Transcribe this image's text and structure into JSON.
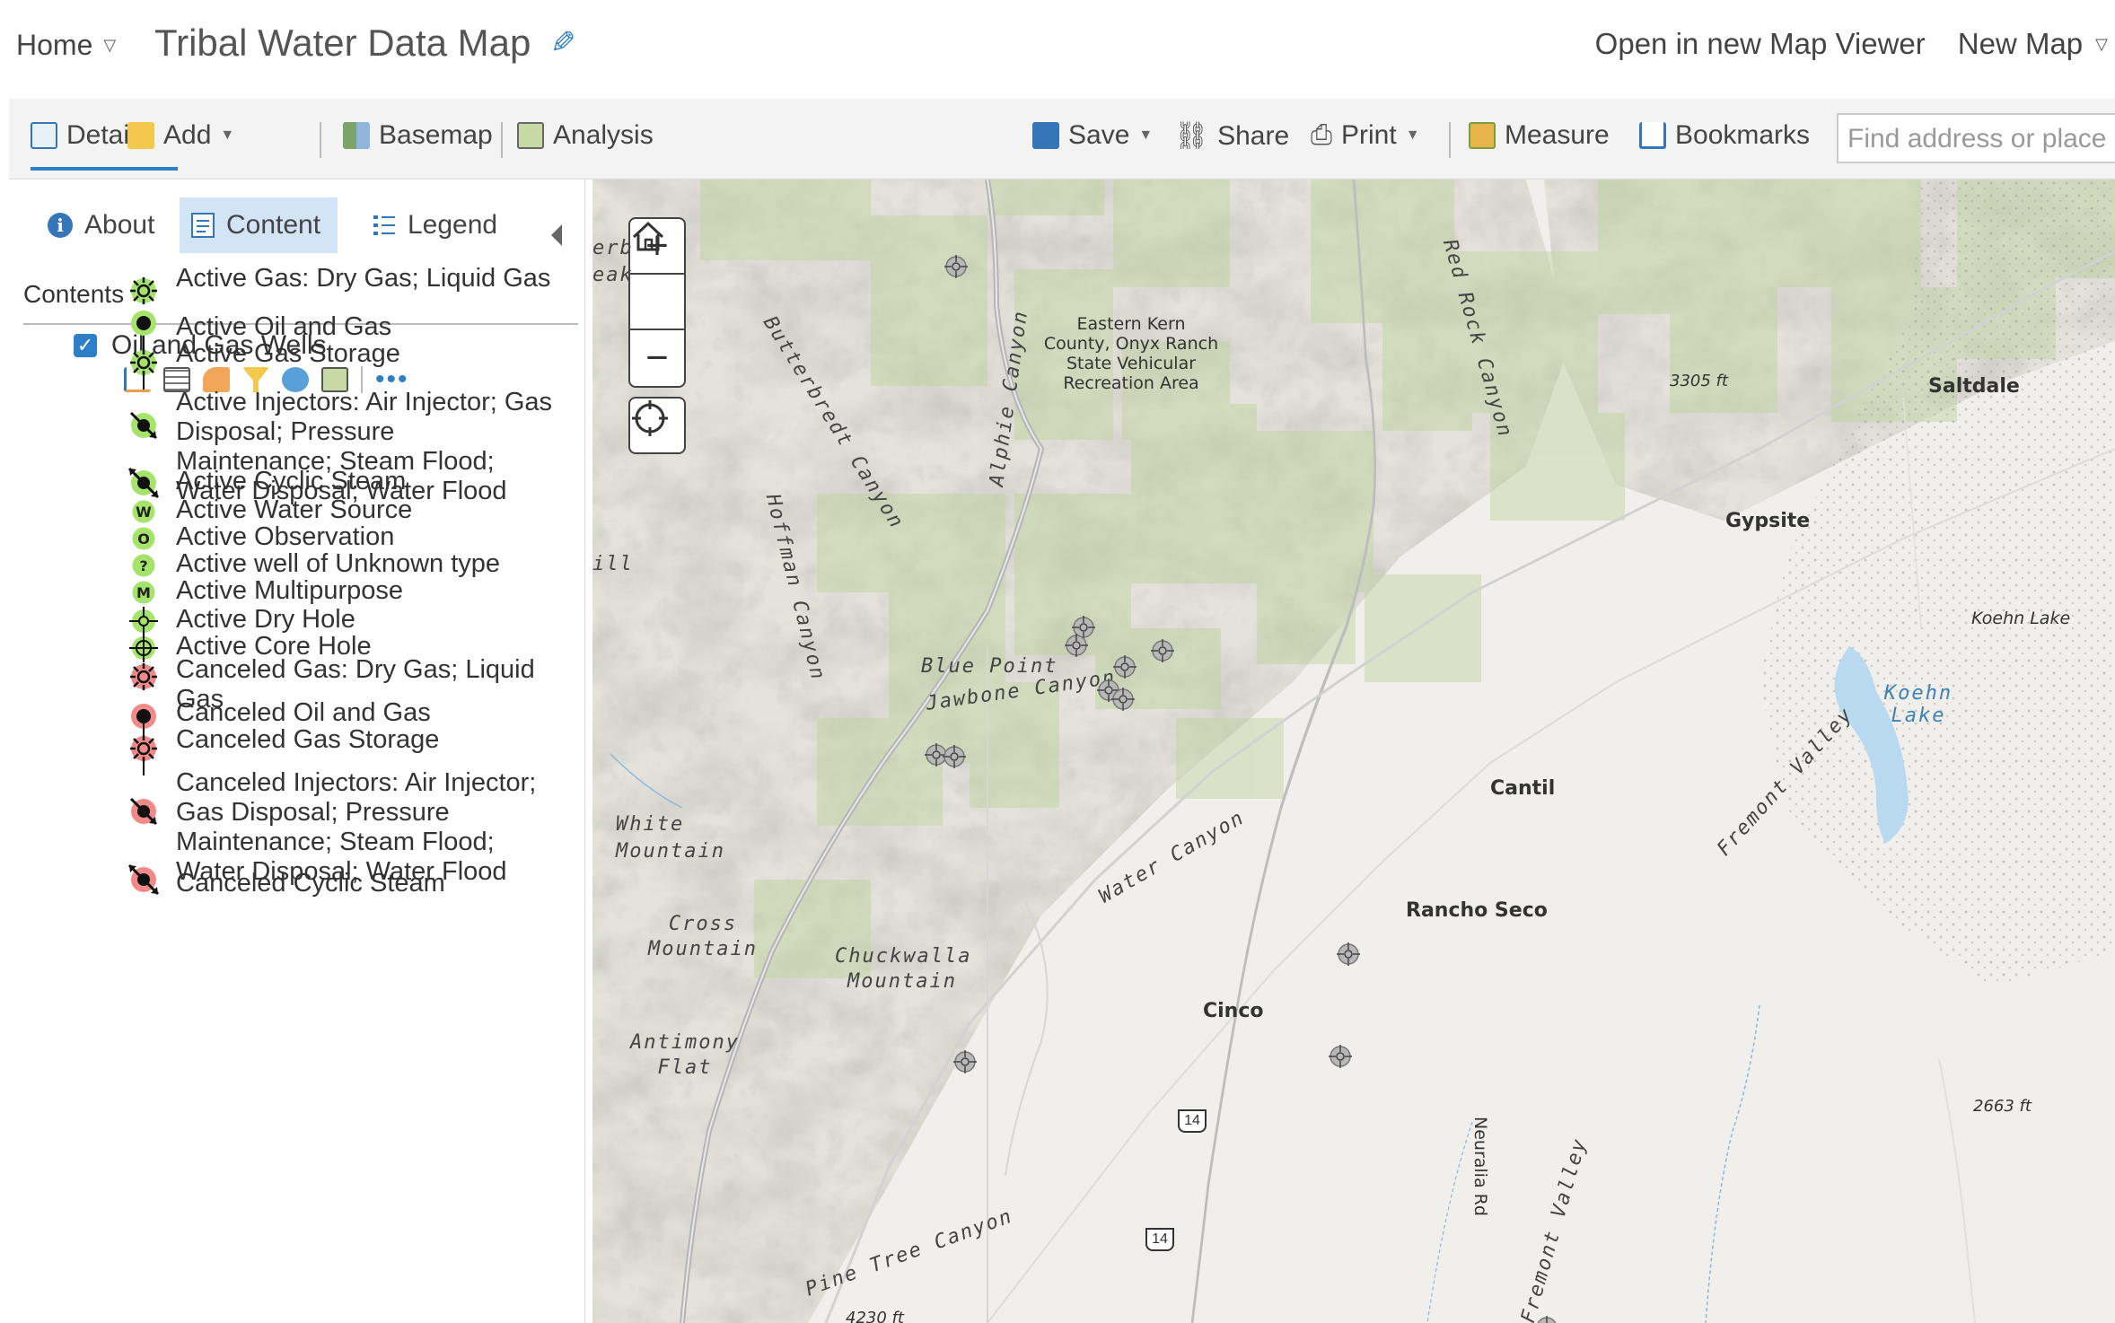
{
  "header": {
    "home_label": "Home",
    "map_title": "Tribal Water Data Map",
    "open_new_viewer": "Open in new Map Viewer",
    "new_map": "New Map"
  },
  "toolbar": {
    "details": "Details",
    "add": "Add",
    "basemap": "Basemap",
    "analysis": "Analysis",
    "save": "Save",
    "share": "Share",
    "print": "Print",
    "measure": "Measure",
    "bookmarks": "Bookmarks",
    "search_placeholder": "Find address or place"
  },
  "panel": {
    "tabs": {
      "about": "About",
      "content": "Content",
      "legend": "Legend"
    },
    "contents_label": "Contents",
    "layer_name": "Oil and Gas Wells",
    "legend_items": [
      {
        "label": "Active Gas: Dry Gas; Liquid Gas",
        "symbol": "gas",
        "color": "#a6e36a"
      },
      {
        "label": "Active Oil and Gas",
        "symbol": "oilgas",
        "color": "#a6e36a"
      },
      {
        "label": "Active Gas Storage",
        "symbol": "storage",
        "color": "#a6e36a"
      },
      {
        "label": "Active Injectors: Air Injector; Gas Disposal; Pressure Maintenance; Steam Flood; Water Disposal; Water Flood",
        "symbol": "injector",
        "color": "#a6e36a"
      },
      {
        "label": "Active Cyclic Steam",
        "symbol": "cyclic",
        "color": "#a6e36a"
      },
      {
        "label": "Active Water Source",
        "symbol": "letter",
        "letter": "W",
        "color": "#a6e36a"
      },
      {
        "label": "Active Observation",
        "symbol": "letter",
        "letter": "O",
        "color": "#a6e36a"
      },
      {
        "label": "Active well of Unknown type",
        "symbol": "letter",
        "letter": "?",
        "color": "#a6e36a"
      },
      {
        "label": "Active Multipurpose",
        "symbol": "letter",
        "letter": "M",
        "color": "#a6e36a"
      },
      {
        "label": "Active Dry Hole",
        "symbol": "dryhole",
        "color": "#a6e36a"
      },
      {
        "label": "Active Core Hole",
        "symbol": "corehole",
        "color": "#a6e36a"
      },
      {
        "label": "Canceled Gas: Dry Gas; Liquid Gas",
        "symbol": "gas",
        "color": "#f08a8a"
      },
      {
        "label": "Canceled Oil and Gas",
        "symbol": "oilgas",
        "color": "#f08a8a"
      },
      {
        "label": "Canceled Gas Storage",
        "symbol": "storage",
        "color": "#f08a8a"
      },
      {
        "label": "Canceled Injectors: Air Injector; Gas Disposal; Pressure Maintenance; Steam Flood; Water Disposal; Water Flood",
        "symbol": "injector",
        "color": "#f08a8a"
      },
      {
        "label": "Canceled Cyclic Steam",
        "symbol": "cyclic",
        "color": "#f08a8a"
      }
    ]
  },
  "map": {
    "controls": {
      "zoom_in": "+",
      "zoom_out": "−"
    },
    "labels": {
      "butterbredt": "Butterbredt Canyon",
      "alphie": "Alphie Canyon",
      "rec_area": "Eastern Kern County, Onyx Ranch State Vehicular Recreation Area",
      "red_rock": "Red Rock Canyon",
      "elev_3305": "3305 ft",
      "saltdale": "Saltdale",
      "gypsite": "Gypsite",
      "koehn_lake_land": "Koehn Lake",
      "koehn_lake_water": "Koehn Lake",
      "hoffman": "Hoffman Canyon",
      "blue_point": "Blue Point",
      "jawbone": "Jawbone Canyon",
      "cantil": "Cantil",
      "fremont_valley_1": "Fremont Valley",
      "white_mountain": "White Mountain",
      "water_canyon": "Water Canyon",
      "rancho_seco": "Rancho Seco",
      "cross_mountain": "Cross Mountain",
      "chuckwalla": "Chuckwalla Mountain",
      "cinco": "Cinco",
      "antimony_flat": "Antimony Flat",
      "route_14a": "14",
      "route_14b": "14",
      "neuralia": "Neuralia Rd",
      "fremont_valley_2": "Fremont Valley",
      "elev_2663": "2663 ft",
      "pine_tree": "Pine Tree Canyon",
      "elev_4230": "4230 ft",
      "partial_1": "erb",
      "partial_2": "eak",
      "partial_3": "ill"
    }
  }
}
